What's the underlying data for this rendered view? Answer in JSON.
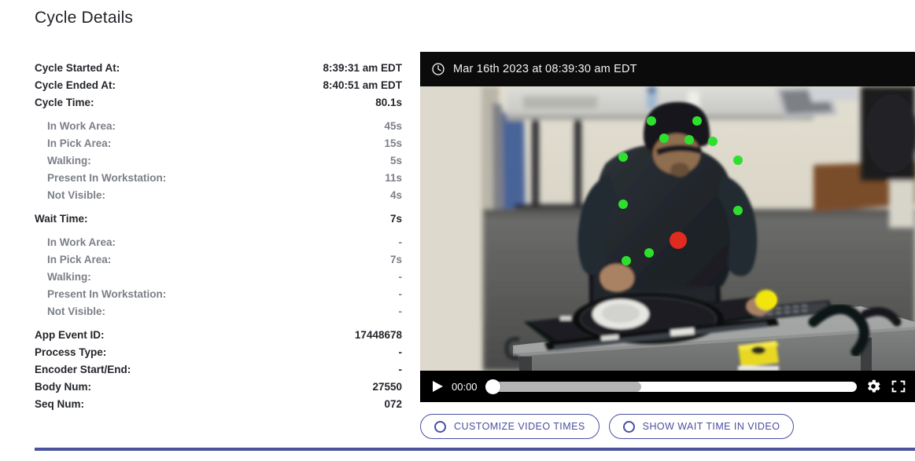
{
  "page": {
    "title": "Cycle Details"
  },
  "details": {
    "rows": [
      {
        "label": "Cycle Started At:",
        "value": "8:39:31 am EDT",
        "sub": false
      },
      {
        "label": "Cycle Ended At:",
        "value": "8:40:51 am EDT",
        "sub": false
      },
      {
        "label": "Cycle Time:",
        "value": "80.1s",
        "sub": false
      },
      {
        "label": "In Work Area:",
        "value": "45s",
        "sub": true
      },
      {
        "label": "In Pick Area:",
        "value": "15s",
        "sub": true
      },
      {
        "label": "Walking:",
        "value": "5s",
        "sub": true
      },
      {
        "label": "Present In Workstation:",
        "value": "11s",
        "sub": true
      },
      {
        "label": "Not Visible:",
        "value": "4s",
        "sub": true
      },
      {
        "label": "Wait Time:",
        "value": "7s",
        "sub": false
      },
      {
        "label": "In Work Area:",
        "value": "-",
        "sub": true
      },
      {
        "label": "In Pick Area:",
        "value": "7s",
        "sub": true
      },
      {
        "label": "Walking:",
        "value": "-",
        "sub": true
      },
      {
        "label": "Present In Workstation:",
        "value": "-",
        "sub": true
      },
      {
        "label": "Not Visible:",
        "value": "-",
        "sub": true
      },
      {
        "label": "App Event ID:",
        "value": "17448678",
        "sub": false
      },
      {
        "label": "Process Type:",
        "value": "-",
        "sub": false
      },
      {
        "label": "Encoder Start/End:",
        "value": "-",
        "sub": false
      },
      {
        "label": "Body Num:",
        "value": "27550",
        "sub": false
      },
      {
        "label": "Seq Num:",
        "value": "072",
        "sub": false
      }
    ]
  },
  "video": {
    "timestamp": "Mar 16th 2023 at 08:39:30 am EDT",
    "clock_icon": "clock-icon",
    "current_time": "00:00",
    "play_icon": "play-icon",
    "settings_icon": "gear-icon",
    "fullscreen_icon": "fullscreen-icon",
    "progress_percent": 0,
    "buffered_percent": 42,
    "scene_description": "Overhead camera view of an industrial workstation; an operator in a dark jacket and cap works at a metal workbench holding a black radiator fan assembly, with pose-estimation keypoints overlaid"
  },
  "actions": {
    "buttons": [
      {
        "label": "CUSTOMIZE VIDEO TIMES",
        "icon": "circle-icon"
      },
      {
        "label": "SHOW WAIT TIME IN VIDEO",
        "icon": "circle-icon"
      }
    ]
  },
  "colors": {
    "accent": "#4a4f9e",
    "divider": "#4a539b",
    "label": "#22252a",
    "sub_label": "#7b7f86",
    "keypoint_green": "#2ee02e",
    "keypoint_red": "#e02b1e",
    "keypoint_yellow": "#f2e50c"
  }
}
